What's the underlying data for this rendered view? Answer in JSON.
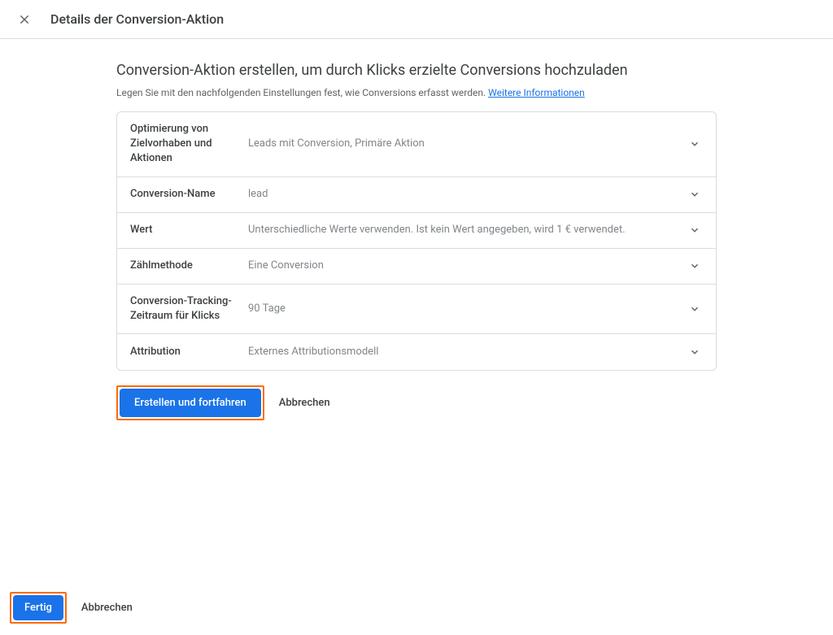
{
  "header": {
    "title": "Details der Conversion-Aktion"
  },
  "main": {
    "heading": "Conversion-Aktion erstellen, um durch Klicks erzielte Conversions hochzuladen",
    "subheading_prefix": "Legen Sie mit den nachfolgenden Einstellungen fest, wie Conversions erfasst werden. ",
    "subheading_link": "Weitere Informationen"
  },
  "settings": [
    {
      "label": "Optimierung von Zielvorhaben und Aktionen",
      "value": "Leads mit Conversion, Primäre Aktion"
    },
    {
      "label": "Conversion-Name",
      "value": "lead"
    },
    {
      "label": "Wert",
      "value": "Unterschiedliche Werte verwenden. Ist kein Wert angegeben, wird 1 € verwendet."
    },
    {
      "label": "Zählmethode",
      "value": "Eine Conversion"
    },
    {
      "label": "Conversion-Tracking-Zeitraum für Klicks",
      "value": "90 Tage"
    },
    {
      "label": "Attribution",
      "value": "Externes Attributionsmodell"
    }
  ],
  "actions": {
    "create_continue": "Erstellen und fortfahren",
    "cancel": "Abbrechen",
    "done": "Fertig",
    "cancel_bottom": "Abbrechen"
  }
}
